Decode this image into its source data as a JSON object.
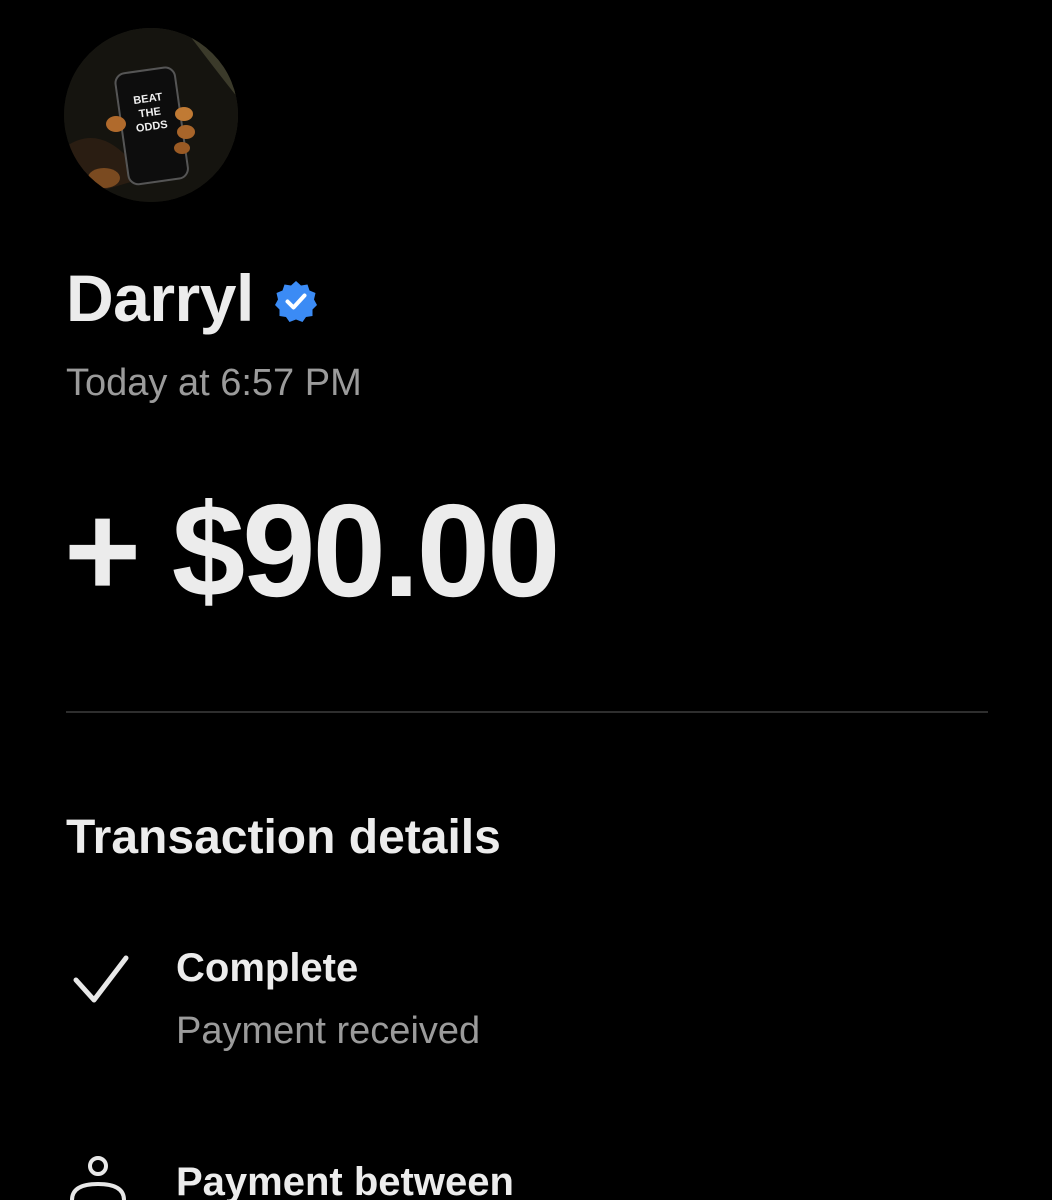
{
  "profile": {
    "name": "Darryl",
    "verified": true,
    "avatar_lettering": [
      "BEAT",
      "THE",
      "ODDS"
    ],
    "timestamp": "Today at 6:57 PM"
  },
  "transaction": {
    "amount": "+ $90.00"
  },
  "details": {
    "title": "Transaction details",
    "items": [
      {
        "icon": "checkmark-icon",
        "title": "Complete",
        "subtitle": "Payment received"
      },
      {
        "icon": "person-icon",
        "title": "Payment between"
      }
    ]
  },
  "colors": {
    "background": "#000000",
    "primary_text": "#ececec",
    "secondary_text": "#9b9b9b",
    "verified_badge": "#3b8bf5",
    "divider": "#2e2e2e"
  }
}
